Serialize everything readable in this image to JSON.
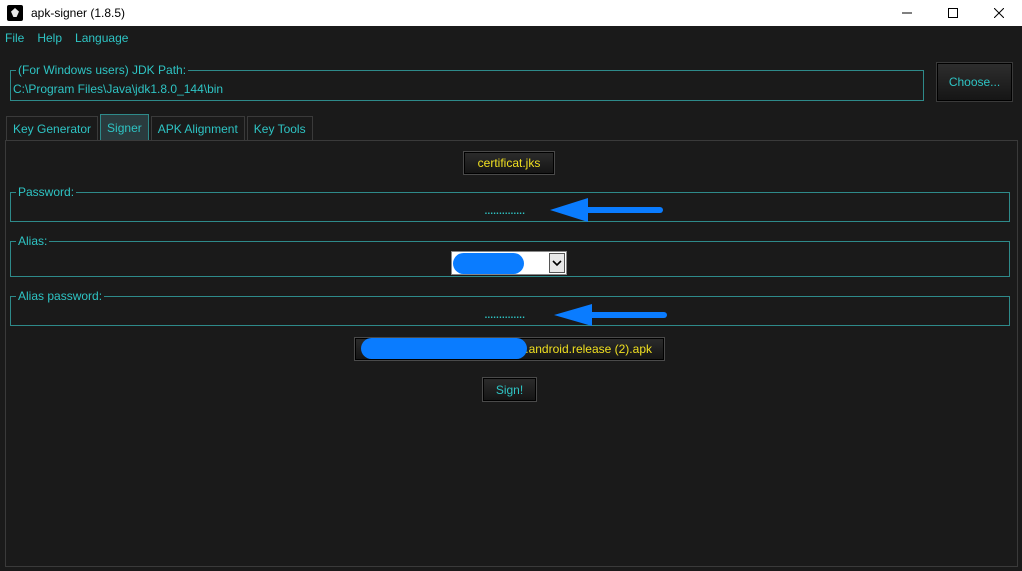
{
  "window": {
    "title": "apk-signer (1.8.5)"
  },
  "menu": {
    "items": [
      "File",
      "Help",
      "Language"
    ]
  },
  "jdk": {
    "legend": "(For Windows users) JDK Path:",
    "path": "C:\\Program Files\\Java\\jdk1.8.0_144\\bin",
    "choose_label": "Choose..."
  },
  "tabs": [
    {
      "label": "Key Generator",
      "active": false
    },
    {
      "label": "Signer",
      "active": true
    },
    {
      "label": "APK Alignment",
      "active": false
    },
    {
      "label": "Key Tools",
      "active": false
    }
  ],
  "signer": {
    "keystore_button": "certificat.jks",
    "password_legend": "Password:",
    "password_mask": "..............",
    "alias_legend": "Alias:",
    "alias_password_legend": "Alias password:",
    "alias_password_mask": "..............",
    "apk_button_suffix": ".android.release (2).apk",
    "sign_label": "Sign!"
  },
  "colors": {
    "accent": "#2ec4c4",
    "button_text": "#f0e020",
    "redaction": "#0a7cff",
    "annotation_arrow": "#0a7cff"
  }
}
